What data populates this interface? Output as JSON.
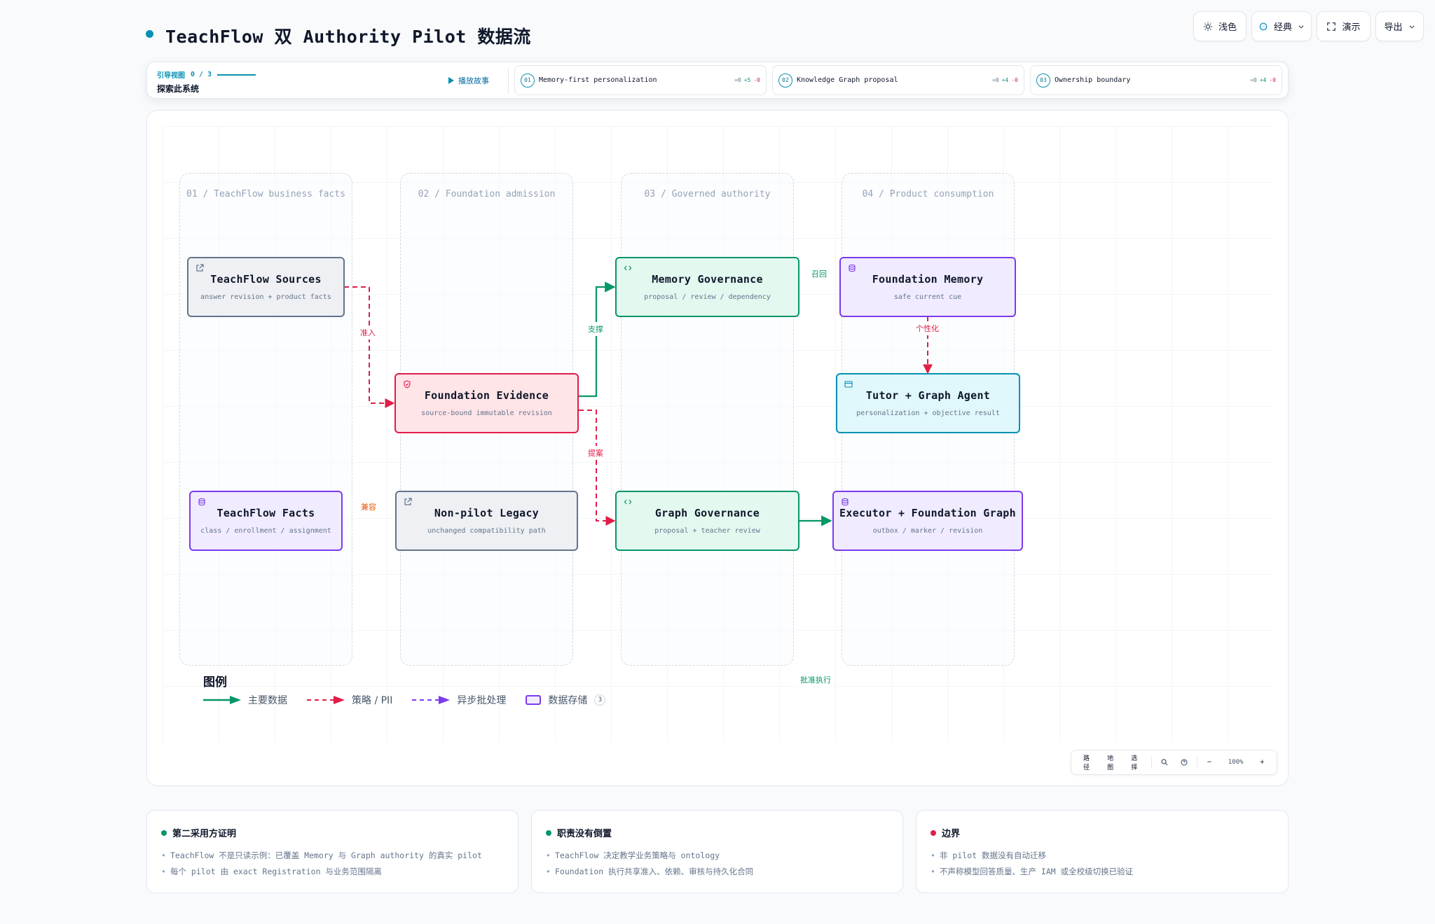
{
  "header": {
    "title": "TeachFlow 双 Authority Pilot 数据流",
    "buttons": {
      "theme": "浅色",
      "style": "经典",
      "present": "演示",
      "export": "导出"
    }
  },
  "guide": {
    "label": "引导视图",
    "progress": "0 / 3",
    "subtitle": "探索此系统",
    "play": "播放故事",
    "steps": [
      {
        "num": "01",
        "text": "Memory-first personalization",
        "eq": "=0",
        "plus": "+5",
        "minus": "-0"
      },
      {
        "num": "02",
        "text": "Knowledge Graph proposal",
        "eq": "=0",
        "plus": "+4",
        "minus": "-0"
      },
      {
        "num": "03",
        "text": "Ownership boundary",
        "eq": "=0",
        "plus": "+4",
        "minus": "-0"
      }
    ]
  },
  "lanes": [
    "01 / TeachFlow business facts",
    "02 / Foundation admission",
    "03 / Governed authority",
    "04 / Product consumption"
  ],
  "nodes": {
    "sources": {
      "title": "TeachFlow Sources",
      "sub": "answer revision + product facts",
      "icon": "external-link-icon"
    },
    "facts": {
      "title": "TeachFlow Facts",
      "sub": "class / enrollment / assignment",
      "icon": "database-icon"
    },
    "evidence": {
      "title": "Foundation Evidence",
      "sub": "source-bound immutable revision",
      "icon": "shield-icon"
    },
    "legacy": {
      "title": "Non-pilot Legacy",
      "sub": "unchanged compatibility path",
      "icon": "external-link-icon"
    },
    "memory_gov": {
      "title": "Memory Governance",
      "sub": "proposal / review / dependency",
      "icon": "code-icon"
    },
    "graph_gov": {
      "title": "Graph Governance",
      "sub": "proposal + teacher review",
      "icon": "code-icon"
    },
    "memory": {
      "title": "Foundation Memory",
      "sub": "safe current cue",
      "icon": "database-icon"
    },
    "agent": {
      "title": "Tutor + Graph Agent",
      "sub": "personalization + objective result",
      "icon": "window-icon"
    },
    "executor": {
      "title": "Executor + Foundation Graph",
      "sub": "outbox / marker / revision",
      "icon": "database-icon"
    }
  },
  "edge_labels": {
    "admit": "准入",
    "support": "支撑",
    "propose": "提案",
    "recall": "召回",
    "personalize": "个性化",
    "compat": "兼容",
    "approve": "批准执行"
  },
  "legend": {
    "title": "图例",
    "main": "主要数据",
    "policy": "策略 / PII",
    "async": "异步批处理",
    "store": "数据存储",
    "store_count": "3"
  },
  "toolbar": {
    "path": "路径",
    "map": "地图",
    "select": "选择",
    "zoom": "100%",
    "minus": "−",
    "plus": "+"
  },
  "cards": [
    {
      "title": "第二采用方证明",
      "dot": "#059669",
      "items": [
        "TeachFlow 不是只读示例：已覆盖 Memory 与 Graph authority 的真实 pilot",
        "每个 pilot 由 exact Registration 与业务范围隔离"
      ]
    },
    {
      "title": "职责没有倒置",
      "dot": "#059669",
      "items": [
        "TeachFlow 决定教学业务策略与 ontology",
        "Foundation 执行共享准入、依赖、审核与持久化合同"
      ]
    },
    {
      "title": "边界",
      "dot": "#e11d48",
      "items": [
        "非 pilot 数据没有自动迁移",
        "不声称模型回答质量、生产 IAM 或全校级切换已验证"
      ]
    }
  ],
  "colors": {
    "main": "#059669",
    "policy": "#e11d48",
    "async": "#7c3aed",
    "accent": "#0891b2"
  }
}
